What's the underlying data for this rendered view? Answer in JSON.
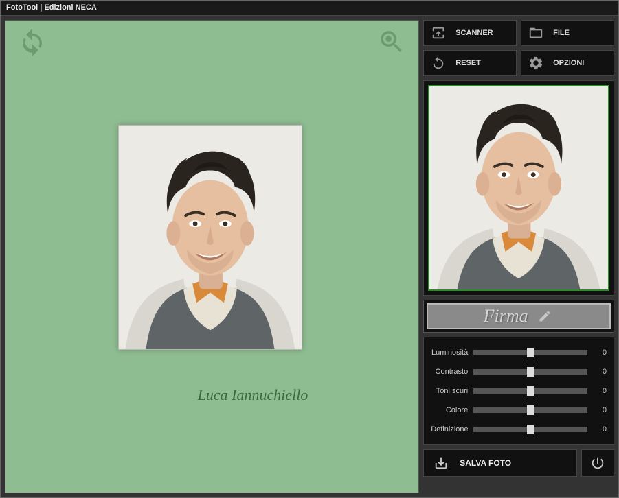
{
  "titlebar": "FotoTool    |    Edizioni NECA",
  "tools": {
    "scanner": "SCANNER",
    "file": "FILE",
    "reset": "RESET",
    "opzioni": "OPZIONI"
  },
  "firma": "Firma",
  "signature_text": "Luca Iannuchiello",
  "sliders": [
    {
      "label": "Luminosità",
      "value": 0
    },
    {
      "label": "Contrasto",
      "value": 0
    },
    {
      "label": "Toni scuri",
      "value": 0
    },
    {
      "label": "Colore",
      "value": 0
    },
    {
      "label": "Definizione",
      "value": 0
    }
  ],
  "save": "SALVA FOTO"
}
